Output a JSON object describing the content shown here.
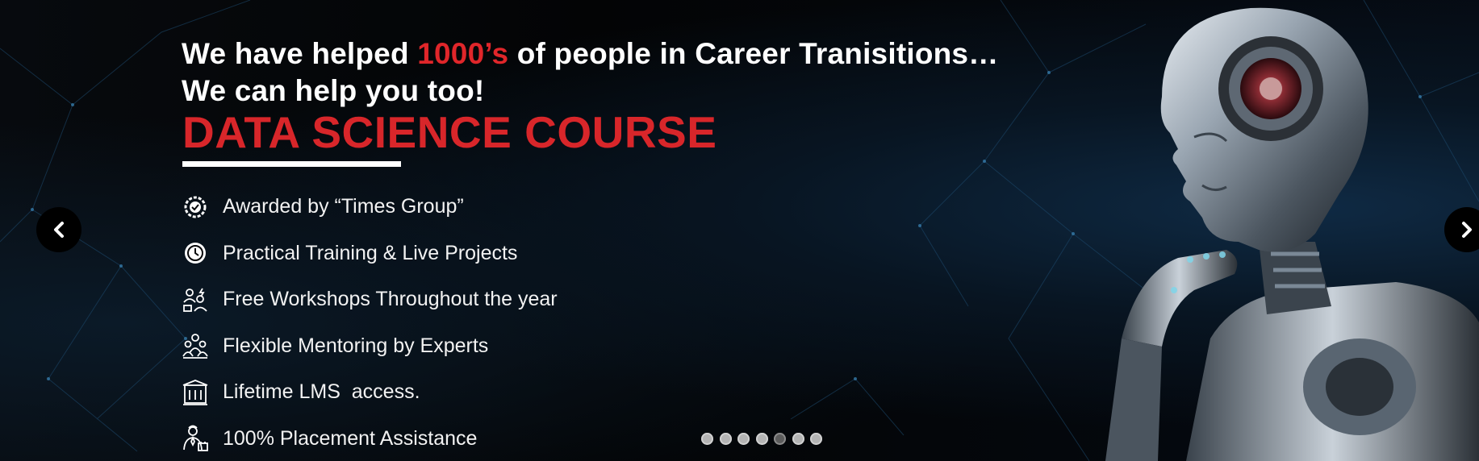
{
  "banner": {
    "headline_line1_before": "We have helped ",
    "headline_line1_accent": "1000’s",
    "headline_line1_after": " of people in Career Tranisitions…",
    "headline_line2": "We can help you too!",
    "course_title": "DATA SCIENCE COURSE",
    "features": [
      {
        "icon": "award-badge-icon",
        "label": "Awarded by “Times Group”"
      },
      {
        "icon": "clock-icon",
        "label": "Practical Training & Live Projects"
      },
      {
        "icon": "workshop-people-icon",
        "label": "Free Workshops Throughout the year"
      },
      {
        "icon": "mentoring-group-icon",
        "label": "Flexible Mentoring by Experts"
      },
      {
        "icon": "lms-building-icon",
        "label": "Lifetime LMS  access."
      },
      {
        "icon": "placement-person-icon",
        "label": "100% Placement Assistance"
      }
    ],
    "accent_color": "#d8262a"
  },
  "carousel": {
    "prev_icon": "chevron-left-icon",
    "next_icon": "chevron-right-icon",
    "slide_count": 7,
    "active_index": 4
  }
}
